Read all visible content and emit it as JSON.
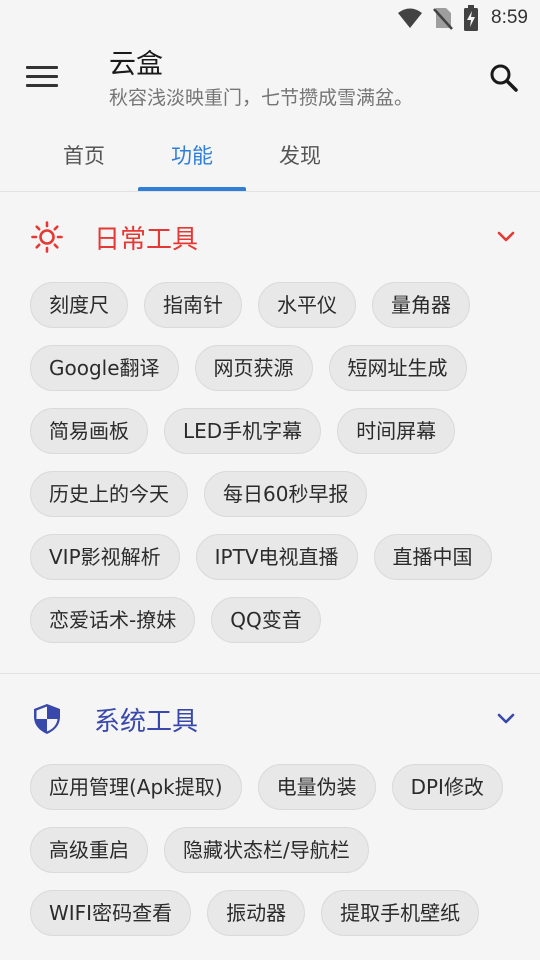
{
  "status_bar": {
    "time": "8:59"
  },
  "app_bar": {
    "title": "云盒",
    "subtitle": "秋容浅淡映重门，七节攒成雪满盆。"
  },
  "tabs": [
    {
      "label": "首页",
      "active": false
    },
    {
      "label": "功能",
      "active": true
    },
    {
      "label": "发现",
      "active": false
    }
  ],
  "colors": {
    "accent": "#2f7fd9",
    "daily_red": "#e53935",
    "system_blue": "#3949ab"
  },
  "sections": [
    {
      "title": "日常工具",
      "icon": "sun-icon",
      "chips": [
        "刻度尺",
        "指南针",
        "水平仪",
        "量角器",
        "Google翻译",
        "网页获源",
        "短网址生成",
        "简易画板",
        "LED手机字幕",
        "时间屏幕",
        "历史上的今天",
        "每日60秒早报",
        "VIP影视解析",
        "IPTV电视直播",
        "直播中国",
        "恋爱话术-撩妹",
        "QQ变音"
      ]
    },
    {
      "title": "系统工具",
      "icon": "shield-icon",
      "chips": [
        "应用管理(Apk提取)",
        "电量伪装",
        "DPI修改",
        "高级重启",
        "隐藏状态栏/导航栏",
        "WIFI密码查看",
        "振动器",
        "提取手机壁纸"
      ]
    }
  ]
}
